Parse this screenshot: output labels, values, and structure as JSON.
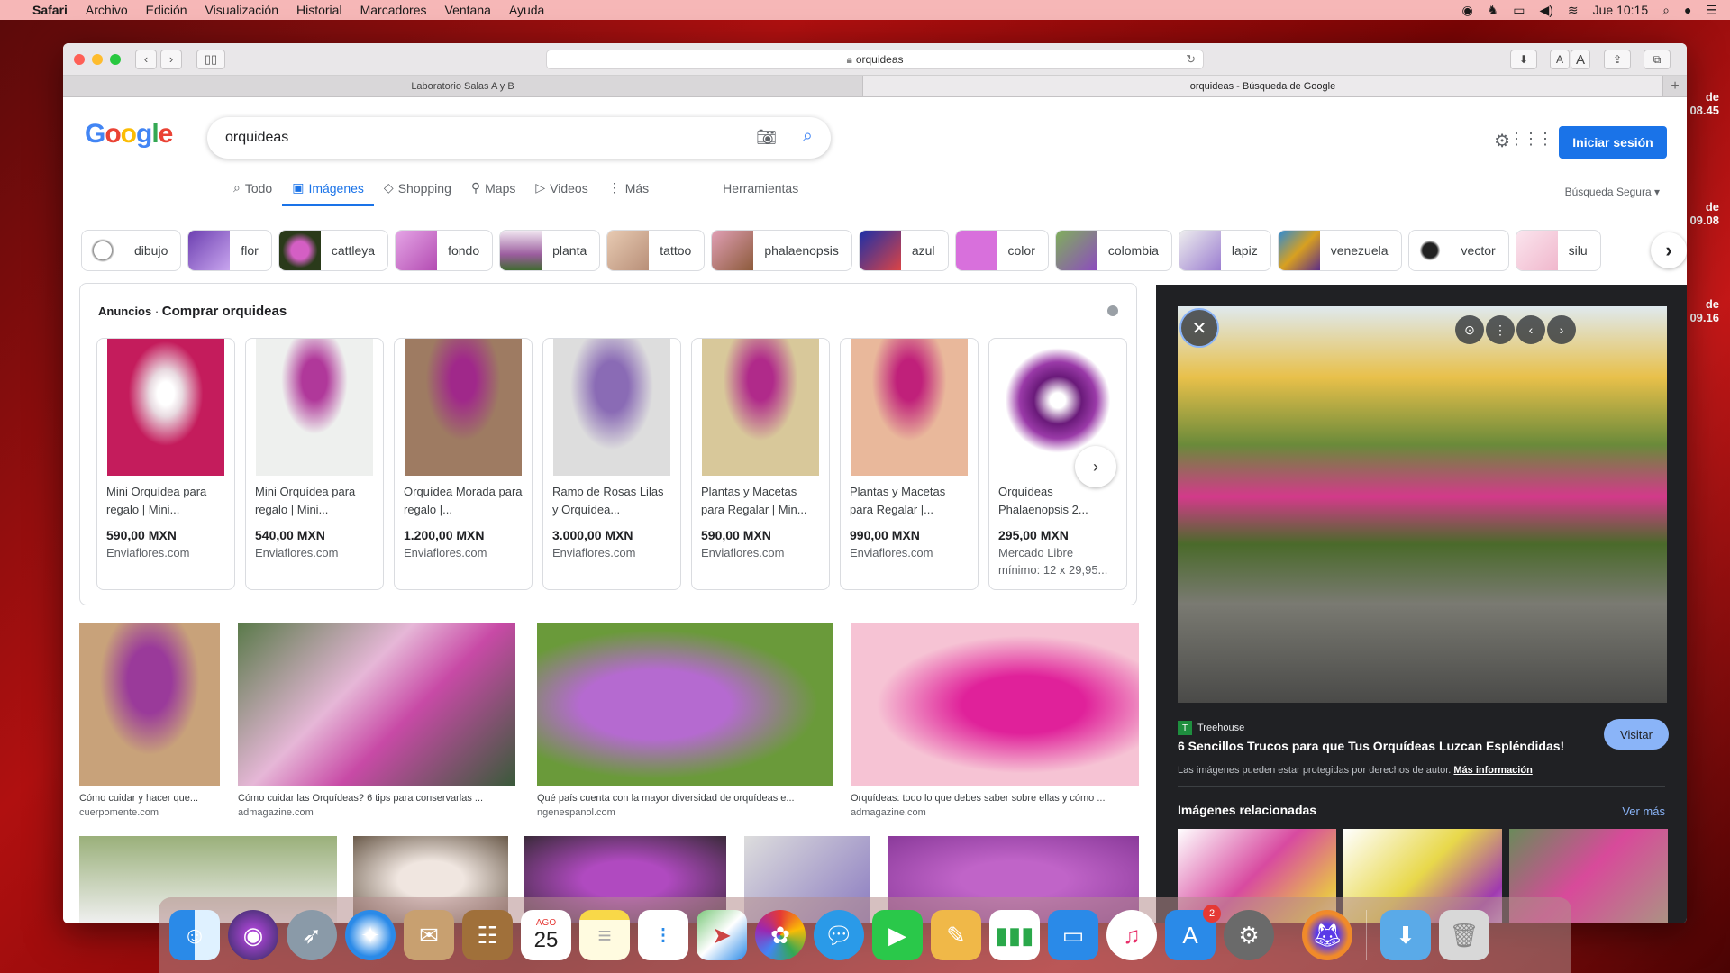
{
  "menubar": {
    "app": "Safari",
    "items": [
      "Archivo",
      "Edición",
      "Visualización",
      "Historial",
      "Marcadores",
      "Ventana",
      "Ayuda"
    ],
    "clock": "Jue 10:15"
  },
  "desktop": {
    "labels": [
      "de\n08.45",
      "de\n09.08",
      "de\n09.16"
    ]
  },
  "browser": {
    "url": "orquideas",
    "tabs": [
      "Laboratorio Salas A y B",
      "orquideas - Búsqueda de Google"
    ],
    "text_size_small": "A",
    "text_size_large": "A"
  },
  "google": {
    "logo": "Google",
    "query": "orquideas",
    "signin": "Iniciar sesión",
    "safe_search": "Búsqueda Segura ▾",
    "tabs": [
      {
        "label": "Todo",
        "icon": "search-icon"
      },
      {
        "label": "Imágenes",
        "icon": "image-icon"
      },
      {
        "label": "Shopping",
        "icon": "tag-icon"
      },
      {
        "label": "Maps",
        "icon": "pin-icon"
      },
      {
        "label": "Videos",
        "icon": "play-icon"
      },
      {
        "label": "Más",
        "icon": "more-icon"
      }
    ],
    "tools": "Herramientas",
    "chips": [
      "dibujo",
      "flor",
      "cattleya",
      "fondo",
      "planta",
      "tattoo",
      "phalaenopsis",
      "azul",
      "color",
      "colombia",
      "lapiz",
      "venezuela",
      "vector",
      "silu"
    ],
    "ads_label": "Anuncios",
    "ads_title": "Comprar orquideas",
    "products": [
      {
        "name": "Mini Orquídea para regalo | Mini...",
        "price": "590,00 MXN",
        "store": "Enviaflores.com"
      },
      {
        "name": "Mini Orquídea para regalo | Mini...",
        "price": "540,00 MXN",
        "store": "Enviaflores.com"
      },
      {
        "name": "Orquídea Morada para regalo |...",
        "price": "1.200,00 MXN",
        "store": "Enviaflores.com"
      },
      {
        "name": "Ramo de Rosas Lilas y Orquídea...",
        "price": "3.000,00 MXN",
        "store": "Enviaflores.com"
      },
      {
        "name": "Plantas y Macetas para Regalar | Min...",
        "price": "590,00 MXN",
        "store": "Enviaflores.com"
      },
      {
        "name": "Plantas y Macetas para Regalar |...",
        "price": "990,00 MXN",
        "store": "Enviaflores.com"
      },
      {
        "name": "Orquídeas Phalaenopsis 2...",
        "price": "295,00 MXN",
        "store": "Mercado Libre\nmínimo: 12 x 29,95..."
      }
    ],
    "results": [
      {
        "caption": "Cómo cuidar y hacer que...",
        "source": "cuerpomente.com"
      },
      {
        "caption": "Cómo cuidar las Orquídeas? 6 tips para conservarlas ...",
        "source": "admagazine.com"
      },
      {
        "caption": "Qué país cuenta con la mayor diversidad de orquídeas e...",
        "source": "ngenespanol.com"
      },
      {
        "caption": "Orquídeas: todo lo que debes saber sobre ellas y cómo ...",
        "source": "admagazine.com"
      }
    ]
  },
  "panel": {
    "source": "Treehouse",
    "title": "6 Sencillos Trucos para que Tus Orquídeas Luzcan Espléndidas!",
    "visit": "Visitar",
    "copyright": "Las imágenes pueden estar protegidas por derechos de autor.",
    "more_info": "Más información",
    "related": "Imágenes relacionadas",
    "see_more": "Ver más"
  },
  "dock": {
    "calendar_month": "AGO",
    "calendar_day": "25",
    "appstore_badge": "2"
  }
}
